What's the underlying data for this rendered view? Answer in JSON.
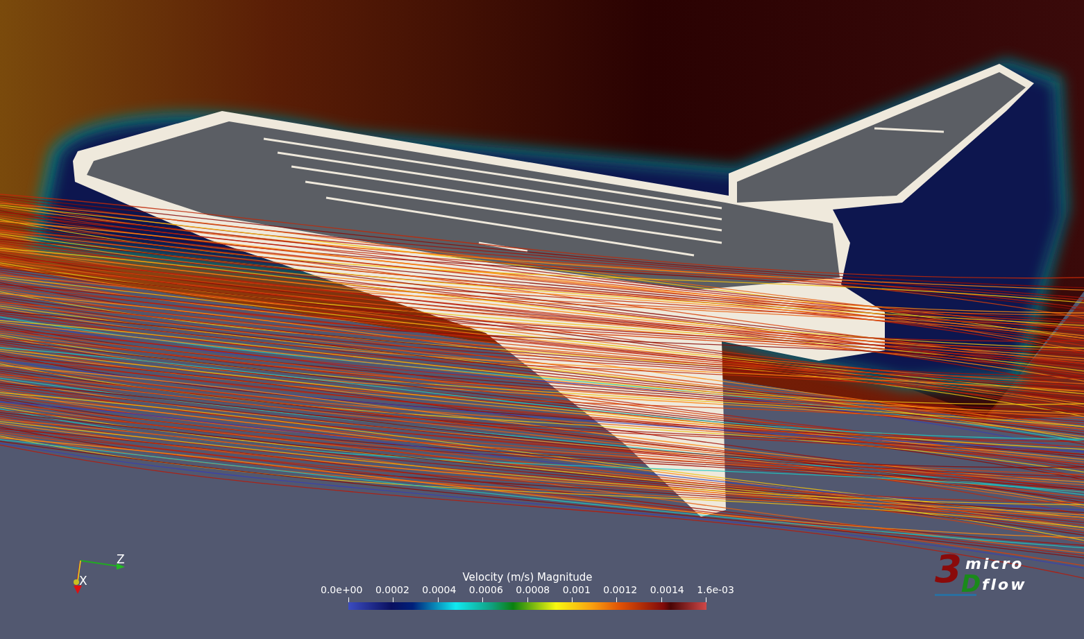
{
  "colorbar": {
    "title": "Velocity (m/s) Magnitude",
    "ticks": [
      "0.0e+00",
      "0.0002",
      "0.0004",
      "0.0006",
      "0.0008",
      "0.001",
      "0.0012",
      "0.0014",
      "1.6e-03"
    ]
  },
  "axes": {
    "z_label": "Z",
    "x_label": "X"
  },
  "logo": {
    "digit": "3",
    "letter": "D",
    "top_word": "micro",
    "bottom_word": "flow"
  }
}
